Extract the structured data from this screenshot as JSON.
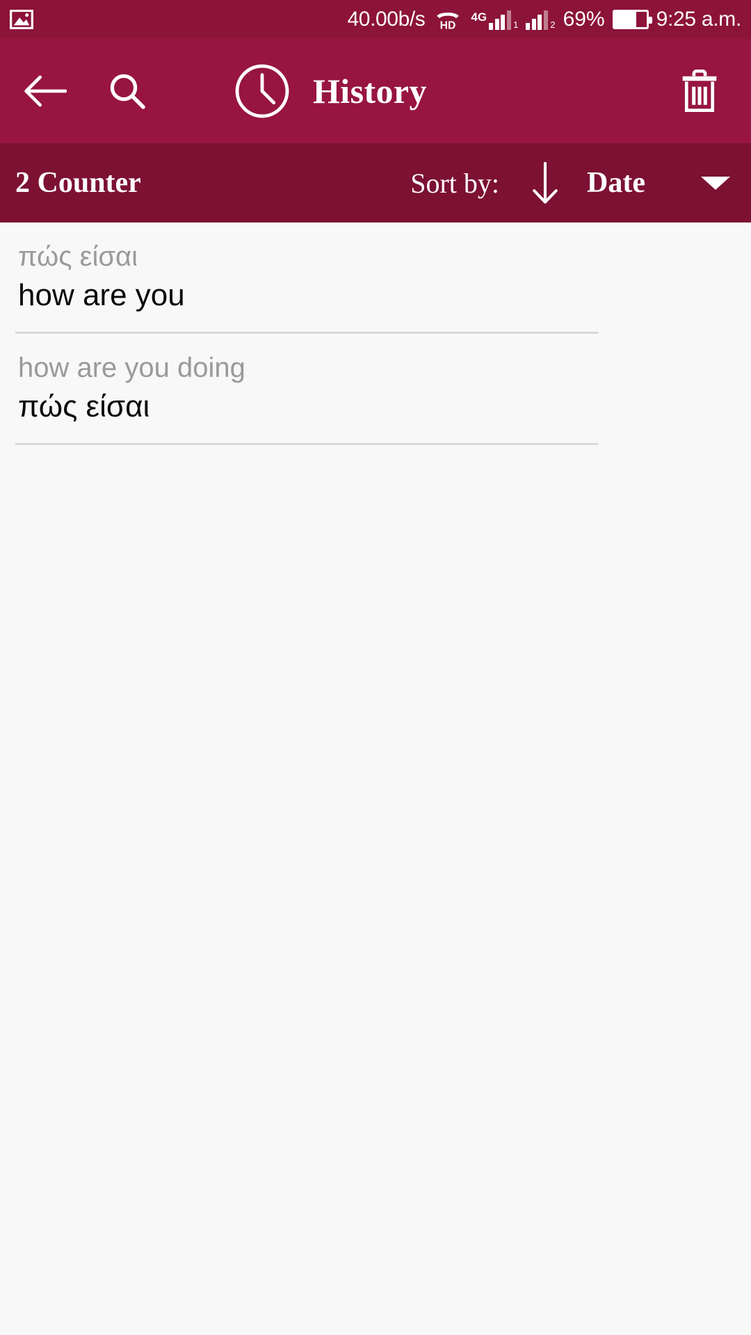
{
  "status_bar": {
    "photo_icon": "image-icon",
    "network_speed": "40.00b/s",
    "hd_icon": "hd-call-icon",
    "network_type": "4G",
    "sim1_label": "1",
    "sim2_label": "2",
    "battery_percent": "69%",
    "battery_level": 69,
    "time": "9:25 a.m."
  },
  "app_bar": {
    "back_icon": "arrow-left-icon",
    "search_icon": "search-icon",
    "clock_icon": "clock-icon",
    "title": "History",
    "delete_icon": "trash-icon",
    "color": "#971540"
  },
  "sort_bar": {
    "counter": "2 Counter",
    "sort_by_label": "Sort by:",
    "sort_direction_icon": "arrow-down-icon",
    "sort_value": "Date",
    "dropdown_icon": "chevron-down-icon",
    "color": "#7C1133"
  },
  "history": {
    "items": [
      {
        "source": "πώς είσαι",
        "translation": "how are you"
      },
      {
        "source": "how are you doing",
        "translation": "πώς είσαι"
      }
    ]
  },
  "colors": {
    "status_bar": "#8C1339",
    "app_bar": "#971540",
    "sort_bar": "#7C1133",
    "content_bg": "#F8F8F8",
    "source_text": "#9A9A9A",
    "translation_text": "#0A0A0A",
    "divider": "#D8D8D8"
  }
}
